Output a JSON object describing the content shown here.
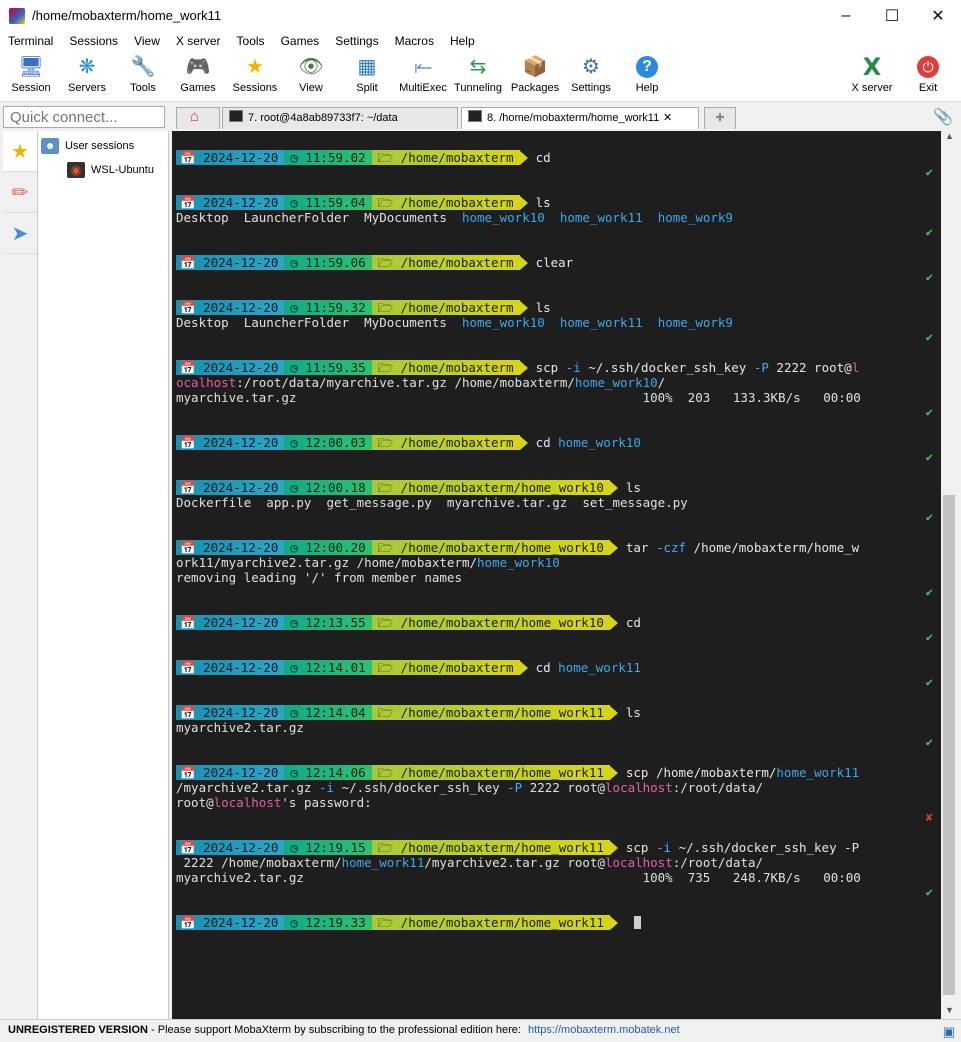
{
  "window": {
    "title": "/home/mobaxterm/home_work11"
  },
  "menu": [
    "Terminal",
    "Sessions",
    "View",
    "X server",
    "Tools",
    "Games",
    "Settings",
    "Macros",
    "Help"
  ],
  "toolbar": {
    "left": [
      {
        "label": "Session",
        "icon": "session-icon"
      },
      {
        "label": "Servers",
        "icon": "servers-icon"
      },
      {
        "label": "Tools",
        "icon": "tools-icon"
      },
      {
        "label": "Games",
        "icon": "games-icon"
      },
      {
        "label": "Sessions",
        "icon": "sessions-star-icon"
      },
      {
        "label": "View",
        "icon": "view-icon"
      },
      {
        "label": "Split",
        "icon": "split-icon"
      },
      {
        "label": "MultiExec",
        "icon": "multiexec-icon"
      },
      {
        "label": "Tunneling",
        "icon": "tunneling-icon"
      },
      {
        "label": "Packages",
        "icon": "packages-icon"
      },
      {
        "label": "Settings",
        "icon": "settings-icon"
      },
      {
        "label": "Help",
        "icon": "help-icon"
      }
    ],
    "right": [
      {
        "label": "X server",
        "icon": "xserver-icon"
      },
      {
        "label": "Exit",
        "icon": "power-icon"
      }
    ]
  },
  "quick_connect": {
    "placeholder": "Quick connect..."
  },
  "tabs": [
    {
      "label": "7. root@4a8ab89733f7: ~/data",
      "active": false
    },
    {
      "label": "8. /home/mobaxterm/home_work11",
      "active": true
    }
  ],
  "sessions": {
    "root_label": "User sessions",
    "items": [
      {
        "label": "WSL-Ubuntu"
      }
    ]
  },
  "terminal": {
    "entries": [
      {
        "date": "2024-12-20",
        "time": "11:59.02",
        "dir": "/home/mobaxterm",
        "cmd": "cd",
        "output": [],
        "status": "ok"
      },
      {
        "date": "2024-12-20",
        "time": "11:59.04",
        "dir": "/home/mobaxterm",
        "cmd": "ls",
        "output": [
          "Desktop  LauncherFolder  MyDocuments  home_work10  home_work11  home_work9"
        ],
        "status": "ok"
      },
      {
        "date": "2024-12-20",
        "time": "11:59.06",
        "dir": "/home/mobaxterm",
        "cmd": "clear",
        "output": [],
        "status": "ok"
      },
      {
        "date": "2024-12-20",
        "time": "11:59.32",
        "dir": "/home/mobaxterm",
        "cmd": "ls",
        "output": [
          "Desktop  LauncherFolder  MyDocuments  home_work10  home_work11  home_work9"
        ],
        "status": "ok"
      },
      {
        "date": "2024-12-20",
        "time": "11:59.35",
        "dir": "/home/mobaxterm",
        "cmd": "scp -i ~/.ssh/docker_ssh_key -P 2222 root@l",
        "output": [
          "ocalhost:/root/data/myarchive.tar.gz /home/mobaxterm/home_work10/",
          "myarchive.tar.gz                                              100%  203   133.3KB/s   00:00"
        ],
        "status": "ok"
      },
      {
        "date": "2024-12-20",
        "time": "12:00.03",
        "dir": "/home/mobaxterm",
        "cmd": "cd home_work10",
        "output": [],
        "status": "ok"
      },
      {
        "date": "2024-12-20",
        "time": "12:00.18",
        "dir": "/home/mobaxterm/home_work10",
        "cmd": "ls",
        "output": [
          "Dockerfile  app.py  get_message.py  myarchive.tar.gz  set_message.py"
        ],
        "status": "ok"
      },
      {
        "date": "2024-12-20",
        "time": "12:00.20",
        "dir": "/home/mobaxterm/home_work10",
        "cmd": "tar -czf /home/mobaxterm/home_w",
        "output": [
          "ork11/myarchive2.tar.gz /home/mobaxterm/home_work10",
          "removing leading '/' from member names"
        ],
        "status": "ok"
      },
      {
        "date": "2024-12-20",
        "time": "12:13.55",
        "dir": "/home/mobaxterm/home_work10",
        "cmd": "cd",
        "output": [],
        "status": "ok"
      },
      {
        "date": "2024-12-20",
        "time": "12:14.01",
        "dir": "/home/mobaxterm",
        "cmd": "cd home_work11",
        "output": [],
        "status": "ok"
      },
      {
        "date": "2024-12-20",
        "time": "12:14.04",
        "dir": "/home/mobaxterm/home_work11",
        "cmd": "ls",
        "output": [
          "myarchive2.tar.gz"
        ],
        "status": "ok"
      },
      {
        "date": "2024-12-20",
        "time": "12:14.06",
        "dir": "/home/mobaxterm/home_work11",
        "cmd": "scp /home/mobaxterm/home_work11",
        "output": [
          "/myarchive2.tar.gz -i ~/.ssh/docker_ssh_key -P 2222 root@localhost:/root/data/",
          "root@localhost's password:"
        ],
        "status": "error"
      },
      {
        "date": "2024-12-20",
        "time": "12:19.15",
        "dir": "/home/mobaxterm/home_work11",
        "cmd": "scp -i ~/.ssh/docker_ssh_key -P",
        "output": [
          " 2222 /home/mobaxterm/home_work11/myarchive2.tar.gz root@localhost:/root/data/",
          "myarchive2.tar.gz                                             100%  735   248.7KB/s   00:00"
        ],
        "status": "ok"
      },
      {
        "date": "2024-12-20",
        "time": "12:19.33",
        "dir": "/home/mobaxterm/home_work11",
        "cmd": "",
        "output": [],
        "status": "current"
      }
    ],
    "check_glyph": "✔",
    "cross_glyph": "✘"
  },
  "statusbar": {
    "version": "UNREGISTERED VERSION",
    "message": "  -  Please support MobaXterm by subscribing to the professional edition here:",
    "link": "https://mobaxterm.mobatek.net"
  }
}
